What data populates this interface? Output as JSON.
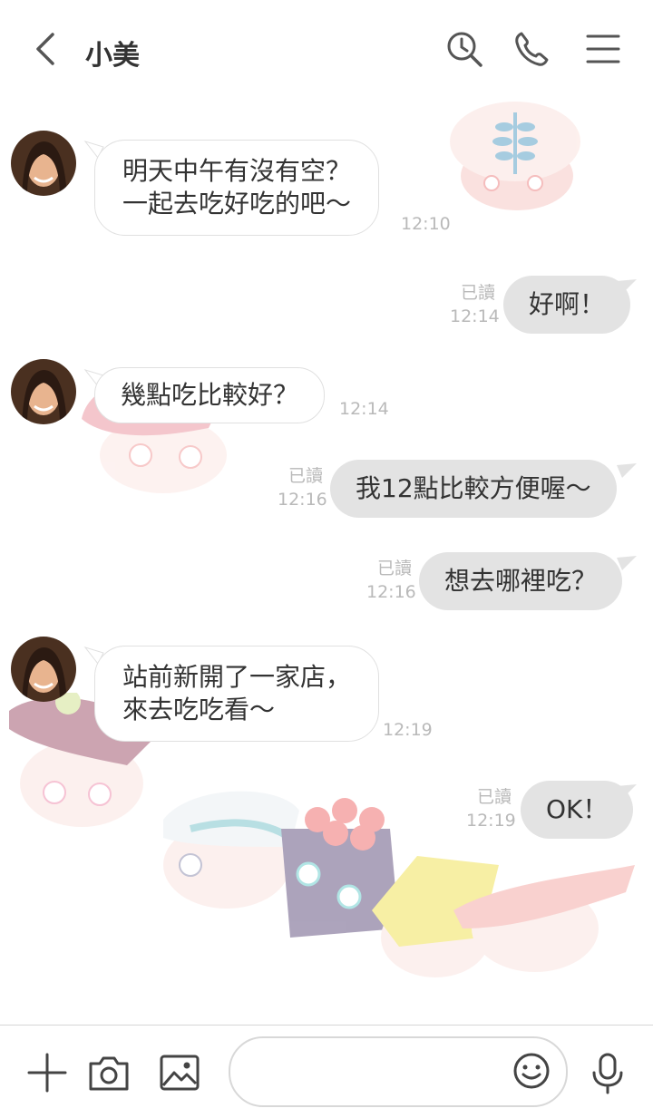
{
  "header": {
    "contact_name": "小美",
    "icons": [
      "back-chevron-icon",
      "search-history-icon",
      "phone-icon",
      "menu-icon"
    ]
  },
  "messages": [
    {
      "side": "in",
      "text": "明天中午有沒有空？\n一起去吃好吃的吧～",
      "time": "12:10"
    },
    {
      "side": "out",
      "text": "好啊！",
      "read": "已讀",
      "time": "12:14"
    },
    {
      "side": "in",
      "text": "幾點吃比較好？",
      "time": "12:14"
    },
    {
      "side": "out",
      "text": "我12點比較方便喔～",
      "read": "已讀",
      "time": "12:16"
    },
    {
      "side": "out",
      "text": "想去哪裡吃？",
      "read": "已讀",
      "time": "12:16"
    },
    {
      "side": "in",
      "text": "站前新開了一家店，\n來去吃吃看～",
      "time": "12:19"
    },
    {
      "side": "out",
      "text": "OK！",
      "read": "已讀",
      "time": "12:19"
    }
  ],
  "composer": {
    "placeholder": "",
    "icons": [
      "plus-icon",
      "camera-icon",
      "image-icon",
      "emoji-icon",
      "microphone-icon"
    ]
  },
  "colors": {
    "incoming_bubble": "#ffffff",
    "outgoing_bubble": "#e3e3e3",
    "meta_text": "#b9b9b9"
  }
}
